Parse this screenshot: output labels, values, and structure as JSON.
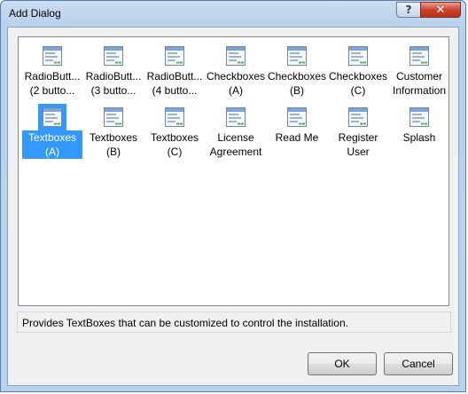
{
  "window": {
    "title": "Add Dialog",
    "help_label": "?",
    "close_label": "✕"
  },
  "dialogs": [
    {
      "label": "RadioButt...\n(2 butto...",
      "selected": false
    },
    {
      "label": "RadioButt...\n(3 butto...",
      "selected": false
    },
    {
      "label": "RadioButt...\n(4 butto...",
      "selected": false
    },
    {
      "label": "Checkboxes\n(A)",
      "selected": false
    },
    {
      "label": "Checkboxes\n(B)",
      "selected": false
    },
    {
      "label": "Checkboxes\n(C)",
      "selected": false
    },
    {
      "label": "Customer\nInformation",
      "selected": false
    },
    {
      "label": "Textboxes\n(A)",
      "selected": true
    },
    {
      "label": "Textboxes\n(B)",
      "selected": false
    },
    {
      "label": "Textboxes\n(C)",
      "selected": false
    },
    {
      "label": "License\nAgreement",
      "selected": false
    },
    {
      "label": "Read Me",
      "selected": false
    },
    {
      "label": "Register\nUser",
      "selected": false
    },
    {
      "label": "Splash",
      "selected": false
    }
  ],
  "status": {
    "description": "Provides TextBoxes that can be customized to control the installation."
  },
  "buttons": {
    "ok": "OK",
    "cancel": "Cancel"
  },
  "colors": {
    "selection": "#3399ff",
    "close_button": "#c7432e",
    "titlebar": "#c9dcf1"
  }
}
